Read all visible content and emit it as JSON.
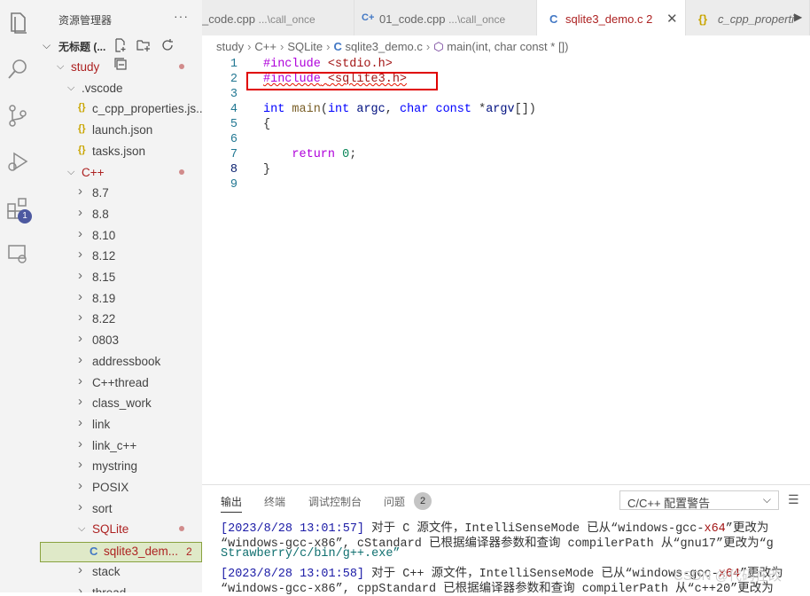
{
  "sidebar": {
    "title": "资源管理器",
    "more": "···",
    "root_label": "无标题 (...",
    "tree": [
      {
        "label": "study",
        "indent": 0,
        "chev": "v",
        "modified": true
      },
      {
        "label": ".vscode",
        "indent": 1,
        "chev": "v"
      },
      {
        "label": "c_cpp_properties.js...",
        "indent": 2,
        "icon": "{}"
      },
      {
        "label": "launch.json",
        "indent": 2,
        "icon": "{}"
      },
      {
        "label": "tasks.json",
        "indent": 2,
        "icon": "{}"
      },
      {
        "label": "C++",
        "indent": 1,
        "chev": "v",
        "modified": true
      },
      {
        "label": "8.7",
        "indent": 2,
        "chev": ">"
      },
      {
        "label": "8.8",
        "indent": 2,
        "chev": ">"
      },
      {
        "label": "8.10",
        "indent": 2,
        "chev": ">"
      },
      {
        "label": "8.12",
        "indent": 2,
        "chev": ">"
      },
      {
        "label": "8.15",
        "indent": 2,
        "chev": ">"
      },
      {
        "label": "8.19",
        "indent": 2,
        "chev": ">"
      },
      {
        "label": "8.22",
        "indent": 2,
        "chev": ">"
      },
      {
        "label": "0803",
        "indent": 2,
        "chev": ">"
      },
      {
        "label": "addressbook",
        "indent": 2,
        "chev": ">"
      },
      {
        "label": "C++thread",
        "indent": 2,
        "chev": ">"
      },
      {
        "label": "class_work",
        "indent": 2,
        "chev": ">"
      },
      {
        "label": "link",
        "indent": 2,
        "chev": ">"
      },
      {
        "label": "link_c++",
        "indent": 2,
        "chev": ">"
      },
      {
        "label": "mystring",
        "indent": 2,
        "chev": ">"
      },
      {
        "label": "POSIX",
        "indent": 2,
        "chev": ">"
      },
      {
        "label": "sort",
        "indent": 2,
        "chev": ">"
      },
      {
        "label": "SQLite",
        "indent": 2,
        "chev": "v",
        "modified": true
      },
      {
        "label": "sqlite3_dem...",
        "indent": 3,
        "icon": "C",
        "selected": true,
        "count": "2"
      },
      {
        "label": "stack",
        "indent": 2,
        "chev": ">"
      },
      {
        "label": "thread",
        "indent": 2,
        "chev": ">"
      }
    ]
  },
  "activity": {
    "extensions_badge": "1"
  },
  "tabs": [
    {
      "icon": "",
      "label": "_code.cpp",
      "desc": "...\\call_once",
      "active": false
    },
    {
      "icon": "C+",
      "label": "01_code.cpp",
      "desc": "...\\call_once",
      "active": false
    },
    {
      "icon": "C",
      "label": "sqlite3_demo.c",
      "count": "2",
      "active": true,
      "close": "✕"
    },
    {
      "icon": "{}",
      "label": "c_cpp_properti",
      "active": false
    }
  ],
  "breadcrumb": {
    "items": [
      "study",
      "C++",
      "SQLite"
    ],
    "file": "sqlite3_demo.c",
    "symbol": "main(int, char const * [])"
  },
  "editor": {
    "line_numbers": [
      "1",
      "2",
      "3",
      "4",
      "5",
      "6",
      "7",
      "8",
      "9"
    ],
    "l1_directive": "#include",
    "l1_header": "<stdio.h>",
    "l2_directive": "#include",
    "l2_header": "<sqlite3.h>",
    "l4_type": "int",
    "l4_name": "main",
    "l4_open": "(",
    "l4_t1": "int",
    "l4_p1": "argc",
    "l4_comma": ", ",
    "l4_t2": "char",
    "l4_t3": "const",
    "l4_star": " *",
    "l4_p2": "argv",
    "l4_close": "[])",
    "l5": "{",
    "l7_kw": "return",
    "l7_num": "0",
    "l7_semi": ";",
    "l8": "}"
  },
  "panel": {
    "tabs": [
      "输出",
      "终端",
      "调试控制台",
      "问题"
    ],
    "problems_count": "2",
    "channel": "C/C++ 配置警告",
    "log1_ts": "[2023/8/28 13:01:57]",
    "log1_a": " 对于 C 源文件，IntelliSenseMode 已从“windows-gcc-",
    "log1_x64": "x64",
    "log1_b": "”更改为",
    "log1_l2": "“windows-gcc-x86”, cStandard 已根据编译器参数和查询 compilerPath 从“gnu17”更改为“g",
    "log1_l3": "Strawberry/c/bin/g++.exe”",
    "log2_ts": "[2023/8/28 13:01:58]",
    "log2_a": " 对于 C++ 源文件，IntelliSenseMode 已从“windows-gcc-",
    "log2_x64": "x64",
    "log2_b": "”更改为",
    "log2_l2": "“windows-gcc-x86”, cppStandard 已根据编译器参数和查询 compilerPath 从“c++20”更改为"
  },
  "watermark": "CSDN @代码在改"
}
